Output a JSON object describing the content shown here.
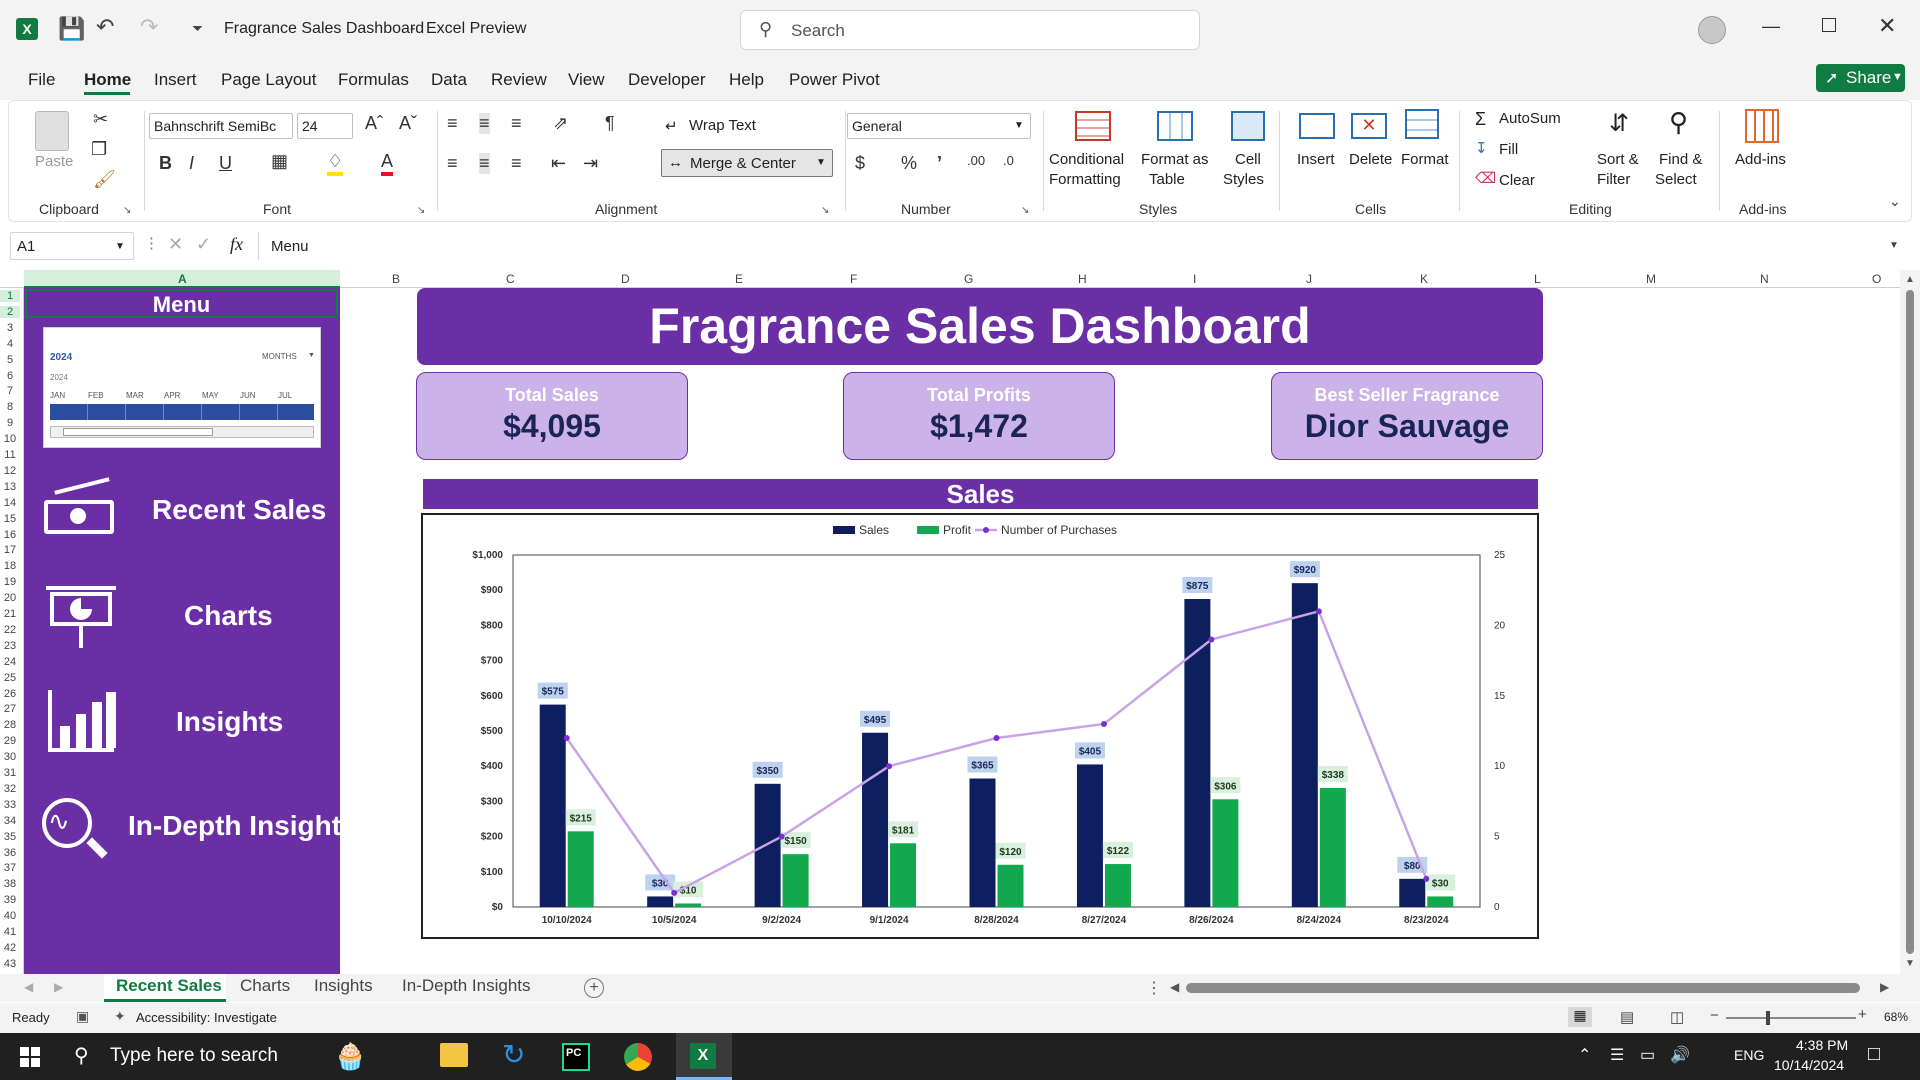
{
  "titlebar": {
    "doc_title": "Fragrance Sales Dashboard",
    "app_name": "Excel Preview",
    "search_placeholder": "Search"
  },
  "menu_tabs": [
    "File",
    "Home",
    "Insert",
    "Page Layout",
    "Formulas",
    "Data",
    "Review",
    "View",
    "Developer",
    "Help",
    "Power Pivot"
  ],
  "active_tab": "Home",
  "share_label": "Share",
  "ribbon": {
    "clipboard": {
      "paste": "Paste",
      "group": "Clipboard"
    },
    "font": {
      "name": "Bahnschrift SemiBc",
      "size": "24",
      "group": "Font"
    },
    "alignment": {
      "wrap": "Wrap Text",
      "merge": "Merge & Center",
      "group": "Alignment"
    },
    "number": {
      "format": "General",
      "group": "Number"
    },
    "styles": {
      "cond1": "Conditional",
      "cond2": "Formatting",
      "fat1": "Format as",
      "fat2": "Table",
      "cs1": "Cell",
      "cs2": "Styles",
      "group": "Styles"
    },
    "cells": {
      "insert": "Insert",
      "delete": "Delete",
      "format": "Format",
      "group": "Cells"
    },
    "editing": {
      "autosum": "AutoSum",
      "fill": "Fill",
      "clear": "Clear",
      "sort1": "Sort &",
      "sort2": "Filter",
      "find1": "Find &",
      "find2": "Select",
      "group": "Editing"
    },
    "addins": {
      "label": "Add-ins",
      "group": "Add-ins"
    }
  },
  "formula_bar": {
    "name_box": "A1",
    "fx": "fx",
    "content": "Menu"
  },
  "columns": [
    "A",
    "B",
    "C",
    "D",
    "E",
    "F",
    "G",
    "H",
    "I",
    "J",
    "K",
    "L",
    "M",
    "N",
    "O"
  ],
  "sidebar": {
    "header": "Menu",
    "timeline": {
      "year": "2024",
      "sub_year": "2024",
      "level": "MONTHS",
      "months": [
        "JAN",
        "FEB",
        "MAR",
        "APR",
        "MAY",
        "JUN",
        "JUL"
      ]
    },
    "nav": [
      "Recent Sales",
      "Charts",
      "Insights",
      "In-Depth Insights"
    ]
  },
  "dashboard": {
    "title": "Fragrance Sales Dashboard",
    "cards": [
      {
        "label": "Total Sales",
        "value": "$4,095"
      },
      {
        "label": "Total Profits",
        "value": "$1,472"
      },
      {
        "label": "Best Seller Fragrance",
        "value": "Dior Sauvage"
      }
    ],
    "section_title": "Sales"
  },
  "chart_data": {
    "type": "bar",
    "categories": [
      "10/10/2024",
      "10/5/2024",
      "9/2/2024",
      "9/1/2024",
      "8/28/2024",
      "8/27/2024",
      "8/26/2024",
      "8/24/2024",
      "8/23/2024"
    ],
    "series": [
      {
        "name": "Sales",
        "type": "bar",
        "axis": "primary",
        "color": "#0d1f5e",
        "values": [
          575,
          30,
          350,
          495,
          365,
          405,
          875,
          920,
          80
        ],
        "labels": [
          "$575",
          "$30",
          "$350",
          "$495",
          "$365",
          "$405",
          "$875",
          "$920",
          "$80"
        ]
      },
      {
        "name": "Profit",
        "type": "bar",
        "axis": "primary",
        "color": "#12a84d",
        "values": [
          215,
          10,
          150,
          181,
          120,
          122,
          306,
          338,
          30
        ],
        "labels": [
          "$215",
          "$10",
          "$150",
          "$181",
          "$120",
          "$122",
          "$306",
          "$338",
          "$30"
        ]
      },
      {
        "name": "Number of Purchases",
        "type": "line",
        "axis": "secondary",
        "color": "#c9a3e8",
        "values": [
          12,
          1,
          5,
          10,
          12,
          13,
          19,
          21,
          2
        ]
      }
    ],
    "ylim": [
      0,
      1000
    ],
    "yticks": [
      "$0",
      "$100",
      "$200",
      "$300",
      "$400",
      "$500",
      "$600",
      "$700",
      "$800",
      "$900",
      "$1,000"
    ],
    "y2lim": [
      0,
      25
    ],
    "y2ticks": [
      "0",
      "5",
      "10",
      "15",
      "20",
      "25"
    ],
    "legend": "top-center",
    "grid": false
  },
  "sheet_tabs": [
    "Recent Sales",
    "Charts",
    "Insights",
    "In-Depth Insights"
  ],
  "active_sheet": "Recent Sales",
  "status": {
    "ready": "Ready",
    "accessibility": "Accessibility: Investigate",
    "zoom": "68%"
  },
  "taskbar": {
    "search_placeholder": "Type here to search",
    "lang": "ENG",
    "time": "4:38 PM",
    "date": "10/14/2024"
  }
}
